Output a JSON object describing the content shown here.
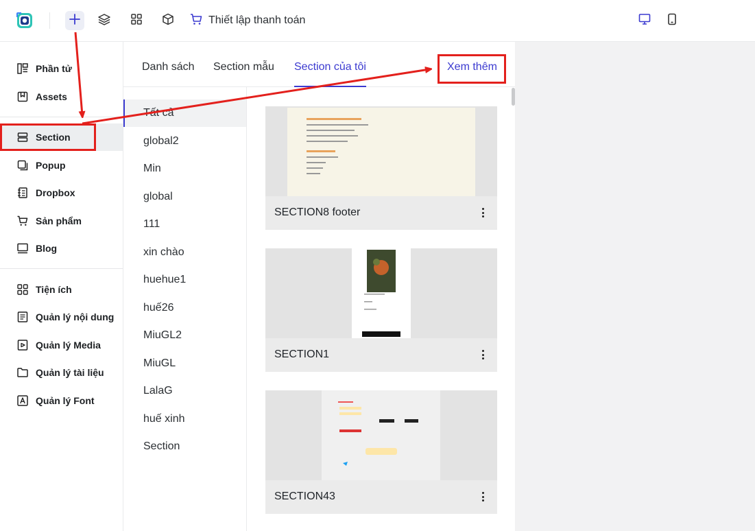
{
  "topbar": {
    "payment_label": "Thiết lập thanh toán",
    "icons": [
      "logo-icon",
      "plus-icon",
      "layers-icon",
      "grid-icon",
      "box-icon",
      "cart-icon",
      "desktop-icon",
      "mobile-icon"
    ]
  },
  "sidebar": {
    "items": [
      {
        "label": "Phần tử",
        "icon": "elements-icon"
      },
      {
        "label": "Assets",
        "icon": "bookmark-icon"
      },
      {
        "label": "Section",
        "icon": "section-icon"
      },
      {
        "label": "Popup",
        "icon": "popup-icon"
      },
      {
        "label": "Dropbox",
        "icon": "dropbox-icon"
      },
      {
        "label": "Sản phẩm",
        "icon": "cart-icon"
      },
      {
        "label": "Blog",
        "icon": "blog-icon"
      },
      {
        "label": "Tiện ích",
        "icon": "apps-icon"
      },
      {
        "label": "Quản lý nội dung",
        "icon": "content-icon"
      },
      {
        "label": "Quản lý Media",
        "icon": "media-icon"
      },
      {
        "label": "Quản lý tài liệu",
        "icon": "folder-icon"
      },
      {
        "label": "Quản lý Font",
        "icon": "font-icon"
      }
    ],
    "active": "Section"
  },
  "tabs": {
    "items": [
      {
        "label": "Danh sách"
      },
      {
        "label": "Section mẫu"
      },
      {
        "label": "Section của tôi"
      }
    ],
    "active": "Section của tôi",
    "more_label": "Xem thêm"
  },
  "categories": {
    "items": [
      "Tất cả",
      "global2",
      "Min",
      "global",
      "111",
      "xin chào",
      "huehue1",
      "huế26",
      "MiuGL2",
      "MiuGL",
      "LalaG",
      "huế xinh",
      "Section"
    ],
    "active": "Tất cả"
  },
  "cards": [
    {
      "title": "SECTION8 footer"
    },
    {
      "title": "SECTION1"
    },
    {
      "title": "SECTION43"
    }
  ],
  "colors": {
    "accent": "#3b3ad0",
    "annotation": "#e3201c",
    "active_bg": "#eceef0"
  }
}
